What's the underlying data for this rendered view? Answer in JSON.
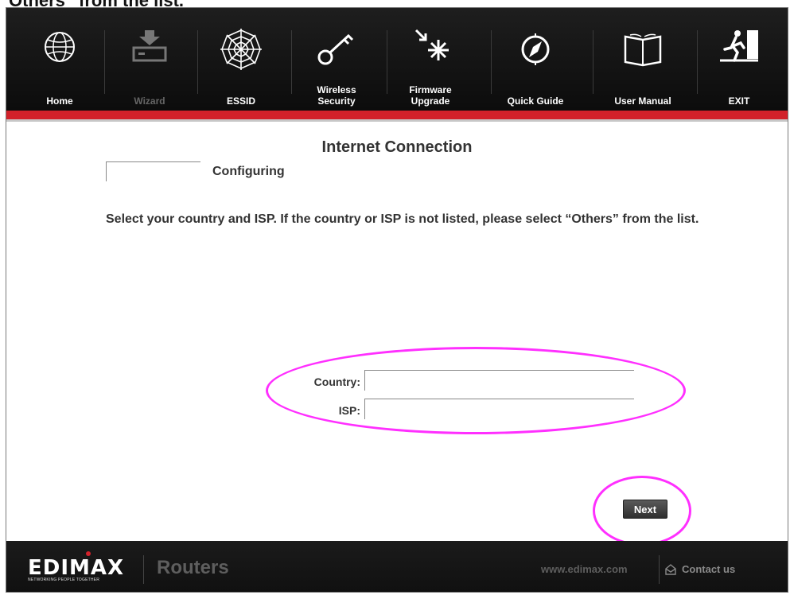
{
  "doc_caption": "“Others” from the list.",
  "nav": {
    "items": [
      {
        "id": "home",
        "label": "Home",
        "icon": "globe-icon",
        "enabled": true
      },
      {
        "id": "wizard",
        "label": "Wizard",
        "icon": "wizard-download-icon",
        "enabled": false
      },
      {
        "id": "essid",
        "label": "ESSID",
        "icon": "spider-web-icon",
        "enabled": true
      },
      {
        "id": "wireless-security",
        "label": "Wireless\nSecurity",
        "icon": "key-icon",
        "enabled": true
      },
      {
        "id": "firmware-upgrade",
        "label": "Firmware\nUpgrade",
        "icon": "firmware-spark-icon",
        "enabled": true
      },
      {
        "id": "quick-guide",
        "label": "Quick Guide",
        "icon": "compass-icon",
        "enabled": true
      },
      {
        "id": "user-manual",
        "label": "User Manual",
        "icon": "book-icon",
        "enabled": true
      },
      {
        "id": "exit",
        "label": "EXIT",
        "icon": "exit-running-man-icon",
        "enabled": true
      }
    ]
  },
  "page": {
    "title": "Internet Connection",
    "status": "Configuring",
    "instructions": "Select your country and ISP. If the country or ISP is not listed, please select “Others” from the list."
  },
  "form": {
    "country_label": "Country:",
    "country_value": "",
    "isp_label": "ISP:",
    "isp_value": ""
  },
  "actions": {
    "next_label": "Next"
  },
  "footer": {
    "brand": "EDIMAX",
    "tagline": "NETWORKING PEOPLE TOGETHER",
    "product": "Routers",
    "website": "www.edimax.com",
    "contact": "Contact us"
  },
  "colors": {
    "accent_red": "#d2212a",
    "highlight_magenta": "#ff2fff",
    "nav_background": "#111111"
  }
}
